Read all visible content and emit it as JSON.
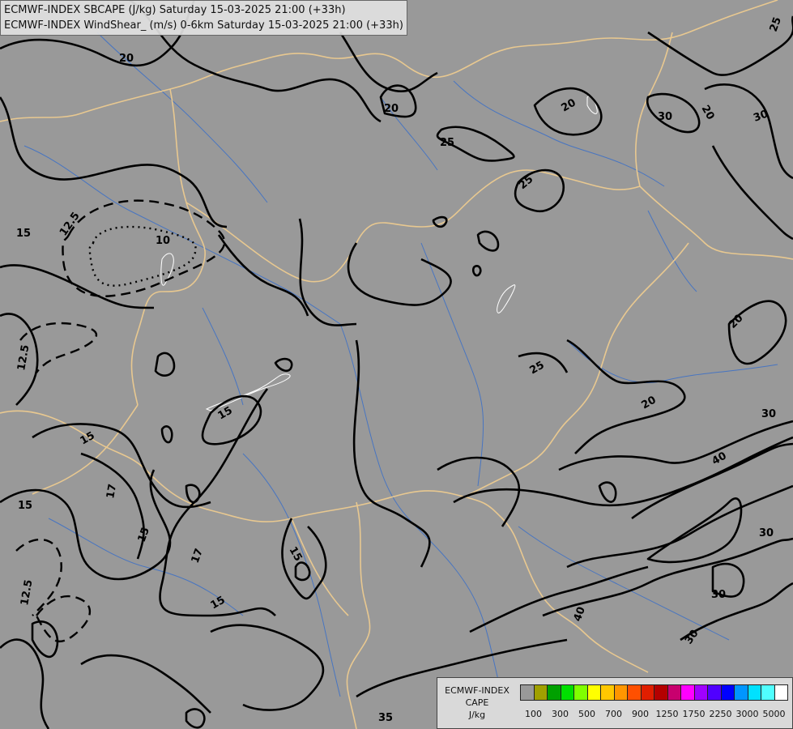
{
  "header": {
    "line1": "ECMWF-INDEX SBCAPE (J/kg) Saturday 15-03-2025 21:00 (+33h)",
    "line2": "ECMWF-INDEX WindShear_ (m/s) 0-6km Saturday 15-03-2025 21:00 (+33h)"
  },
  "colors": {
    "background": "#999999",
    "contour": "#000000",
    "borders": "#e8c890",
    "rivers": "#3a6fc8"
  },
  "contour_labels": [
    "20",
    "20",
    "20",
    "25",
    "25",
    "20",
    "30",
    "30",
    "25",
    "12.5",
    "10",
    "15",
    "12.5",
    "20",
    "25",
    "20",
    "30",
    "15",
    "15",
    "40",
    "17",
    "15",
    "30",
    "17",
    "15",
    "15",
    "12.5",
    "30",
    "40",
    "15",
    "30",
    "35"
  ],
  "legend": {
    "title_line1": "ECMWF-INDEX",
    "title_line2": "CAPE",
    "title_line3": "J/kg",
    "swatches": [
      "#999999",
      "#a0a000",
      "#00a000",
      "#00e000",
      "#80ff00",
      "#ffff00",
      "#ffc800",
      "#ff9600",
      "#ff5000",
      "#e01e00",
      "#b40000",
      "#c8006e",
      "#ff00ff",
      "#a000ff",
      "#5000ff",
      "#0000ff",
      "#0096ff",
      "#00e1ff",
      "#50ffff",
      "#ffffff"
    ],
    "ticks": [
      "100",
      "300",
      "500",
      "700",
      "900",
      "1250",
      "1750",
      "2250",
      "3000",
      "5000"
    ]
  }
}
